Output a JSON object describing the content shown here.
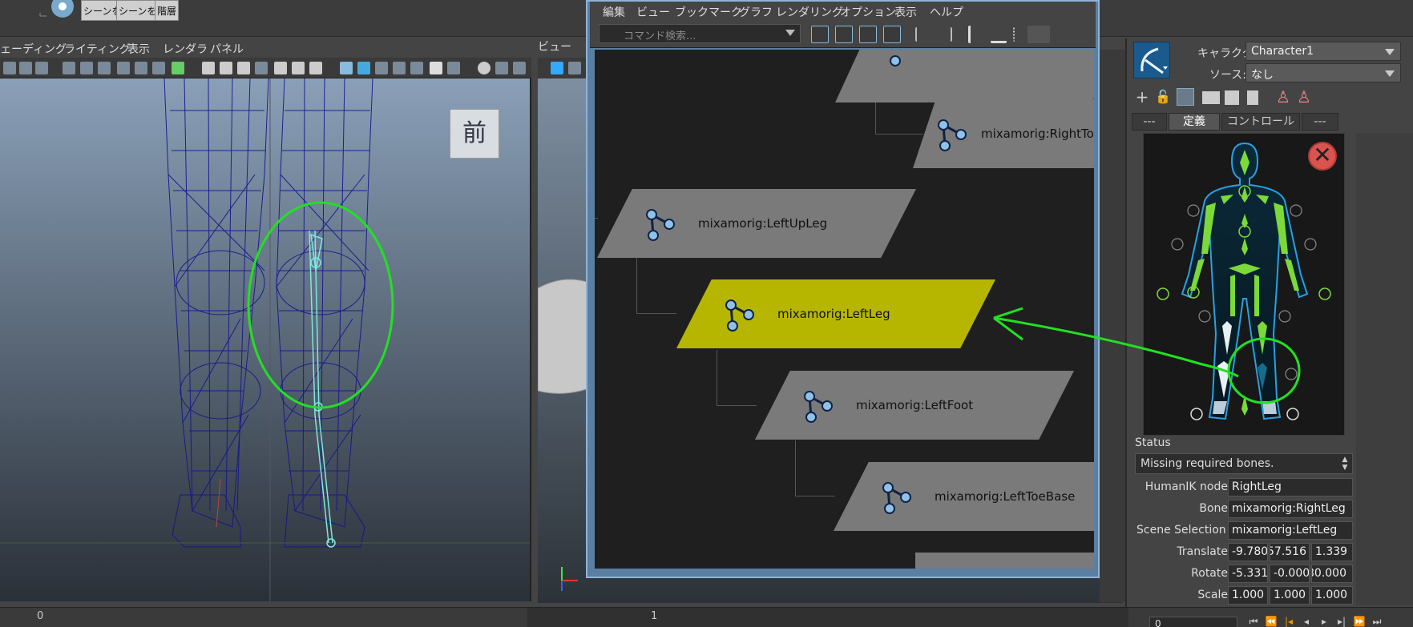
{
  "shelf": {
    "buttons": [
      "シーンを",
      "シーンを",
      "階層"
    ]
  },
  "left_viewport": {
    "menu": [
      "ェーディング",
      "ライティング",
      "表示",
      "レンダラ",
      "パネル"
    ],
    "view_cube_label": "前"
  },
  "middle_viewport": {
    "menu": [
      "ビュー"
    ]
  },
  "node_editor": {
    "menu": [
      "編集",
      "ビュー",
      "ブックマーク",
      "グラフ",
      "レンダリング",
      "オプション",
      "表示",
      "ヘルプ"
    ],
    "search_placeholder": "コマンド検索...",
    "nodes": [
      {
        "label": "mixamorig:RightTo",
        "selected": false
      },
      {
        "label": "mixamorig:LeftUpLeg",
        "selected": false
      },
      {
        "label": "mixamorig:LeftLeg",
        "selected": true
      },
      {
        "label": "mixamorig:LeftFoot",
        "selected": false
      },
      {
        "label": "mixamorig:LeftToeBase",
        "selected": false
      }
    ],
    "colors": {
      "selected": "#b6b600",
      "node": "#7a7a7a",
      "graph_bg": "#1f1f1f"
    }
  },
  "hik_panel": {
    "character_label": "キャラクタ:",
    "character_value": "Character1",
    "source_label": "ソース:",
    "source_value": "なし",
    "tabs": [
      "---",
      "定義",
      "コントロール",
      "---"
    ],
    "active_tab": "定義",
    "status_label": "Status",
    "status_value": "Missing required bones.",
    "fields": {
      "humanik_node_label": "HumanIK node",
      "humanik_node_value": "RightLeg",
      "bone_label": "Bone",
      "bone_value": "mixamorig:RightLeg",
      "scene_selection_label": "Scene Selection",
      "scene_selection_value": "mixamorig:LeftLeg",
      "translate_label": "Translate",
      "translate_values": [
        "-9.780",
        "57.516",
        "1.339"
      ],
      "rotate_label": "Rotate",
      "rotate_values": [
        "-5.331",
        "-0.000",
        "80.000"
      ],
      "scale_label": "Scale",
      "scale_values": [
        "1.000",
        "1.000",
        "1.000"
      ]
    }
  },
  "timeline": {
    "tick_0": "0",
    "tick_1": "1",
    "current_frame": "0"
  },
  "annotation_color": "#22e022"
}
